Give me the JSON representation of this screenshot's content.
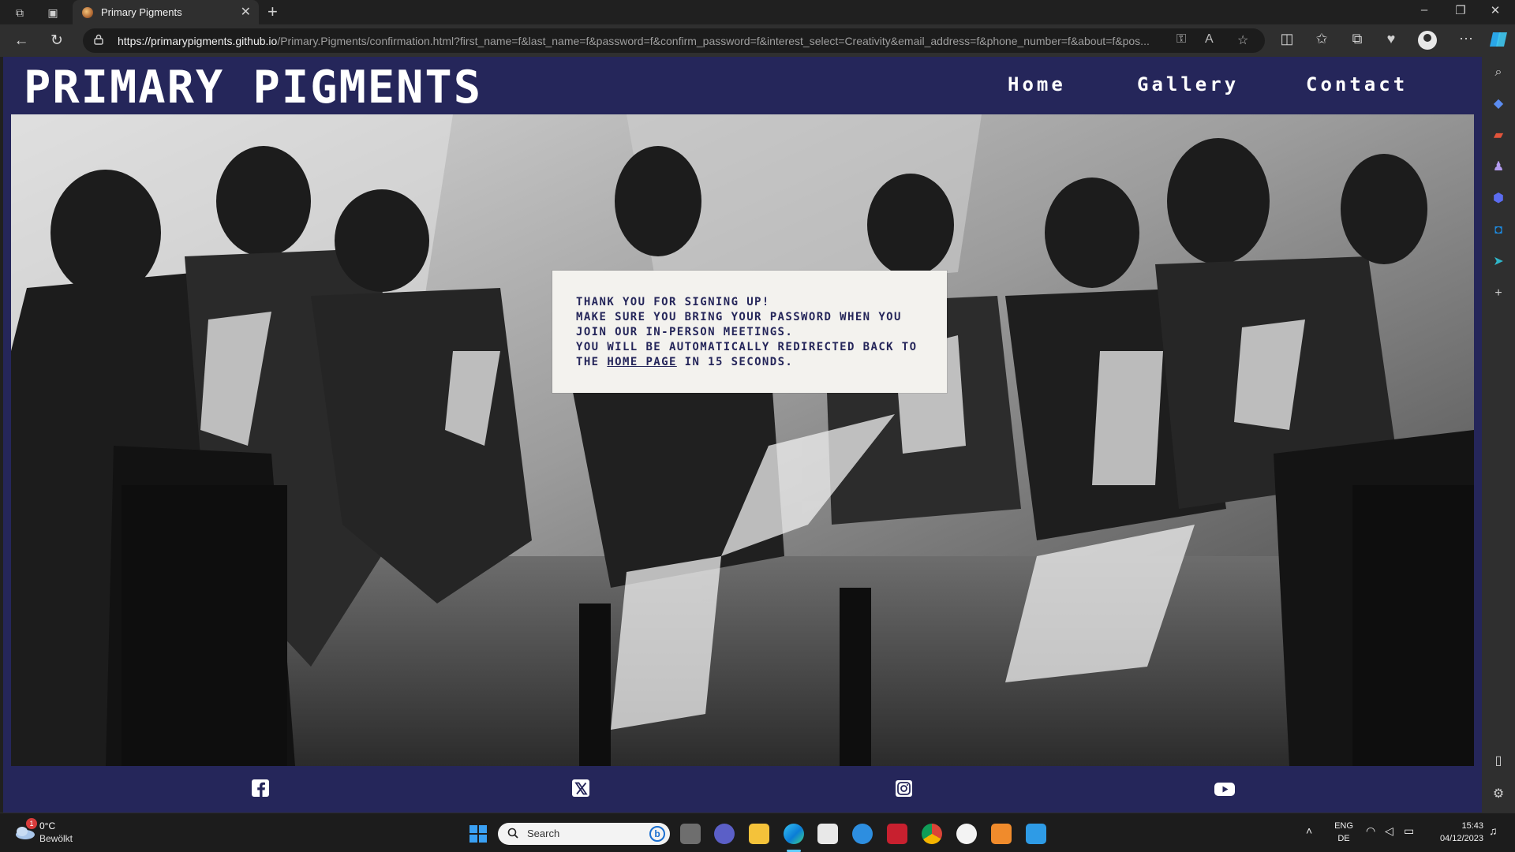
{
  "browser": {
    "tab_title": "Primary Pigments",
    "url_host": "https://primarypigments.github.io",
    "url_path": "/Primary.Pigments/confirmation.html?first_name=f&last_name=f&password=f&confirm_password=f&interest_select=Creativity&email_address=f&phone_number=f&about=f&pos..."
  },
  "site": {
    "brand": "PRIMARY PIGMENTS",
    "nav": [
      "Home",
      "Gallery",
      "Contact"
    ],
    "message": {
      "line1": "Thank you for signing up!",
      "line2": "Make sure you bring your password when you",
      "line3": "join our in-person meetings.",
      "line4": "You will be automatically redirected back to",
      "line5_prefix": "the ",
      "line5_link": "home page",
      "line5_suffix": " in 15 seconds."
    },
    "social": [
      "facebook-icon",
      "x-icon",
      "instagram-icon",
      "youtube-icon"
    ]
  },
  "taskbar": {
    "weather_temp": "0°C",
    "weather_condition": "Bewölkt",
    "weather_badge": "1",
    "search_label": "Search",
    "lang_top": "ENG",
    "lang_bottom": "DE",
    "time": "15:43",
    "date": "04/12/2023"
  },
  "colors": {
    "brand_navy": "#25265a",
    "message_bg": "#f3f2ee"
  }
}
